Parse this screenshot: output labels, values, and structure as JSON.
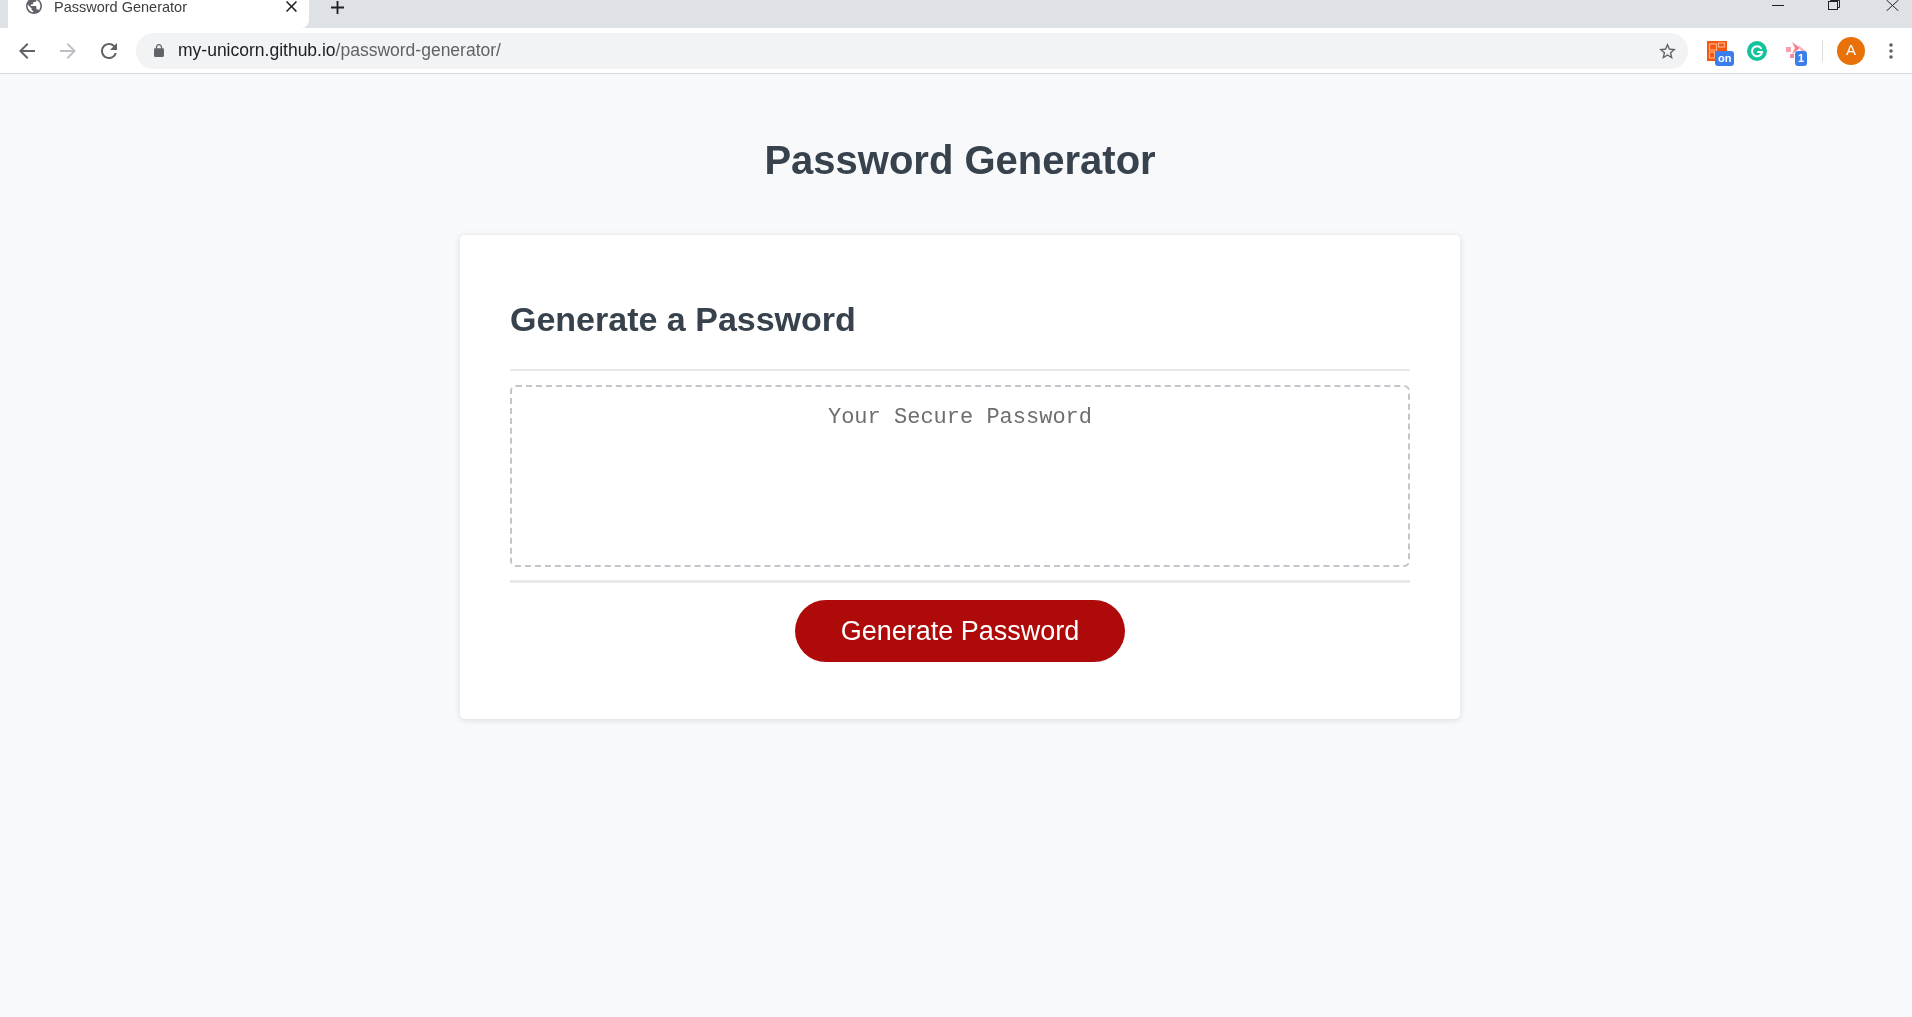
{
  "browser": {
    "tabs": [
      {
        "title": "Password Generator",
        "selected": true
      }
    ],
    "nav_buttons": [
      {
        "kind": "back",
        "disabled": false
      },
      {
        "kind": "forward",
        "disabled": true
      },
      {
        "kind": "reload",
        "disabled": false
      }
    ],
    "address": {
      "host": "my-unicorn.github.io",
      "path": "/password-generator/"
    },
    "extensions": [
      {
        "kind": "tiles",
        "badge": "on"
      },
      {
        "kind": "grammar"
      },
      {
        "kind": "arrows",
        "badge": "1"
      }
    ],
    "profile": {
      "initial": "A"
    }
  },
  "page": {
    "title": "Password Generator",
    "card": {
      "title": "Generate a Password",
      "password_box": {
        "placeholder": "Your Secure Password"
      },
      "button": "Generate Password"
    }
  }
}
